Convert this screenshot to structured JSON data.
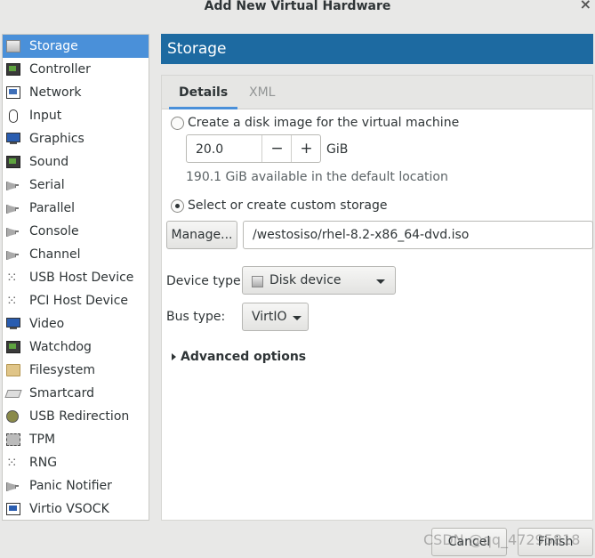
{
  "window": {
    "title": "Add New Virtual Hardware",
    "close_glyph": "×"
  },
  "sidebar": {
    "items": [
      {
        "label": "Storage",
        "icon": "disk-icon"
      },
      {
        "label": "Controller",
        "icon": "controller-chip-icon"
      },
      {
        "label": "Network",
        "icon": "network-card-icon"
      },
      {
        "label": "Input",
        "icon": "mouse-icon"
      },
      {
        "label": "Graphics",
        "icon": "monitor-icon"
      },
      {
        "label": "Sound",
        "icon": "sound-card-icon"
      },
      {
        "label": "Serial",
        "icon": "serial-plug-icon"
      },
      {
        "label": "Parallel",
        "icon": "parallel-plug-icon"
      },
      {
        "label": "Console",
        "icon": "console-plug-icon"
      },
      {
        "label": "Channel",
        "icon": "channel-plug-icon"
      },
      {
        "label": "USB Host Device",
        "icon": "usb-icon"
      },
      {
        "label": "PCI Host Device",
        "icon": "pci-icon"
      },
      {
        "label": "Video",
        "icon": "video-monitor-icon"
      },
      {
        "label": "Watchdog",
        "icon": "watchdog-chip-icon"
      },
      {
        "label": "Filesystem",
        "icon": "folder-icon"
      },
      {
        "label": "Smartcard",
        "icon": "smartcard-icon"
      },
      {
        "label": "USB Redirection",
        "icon": "usb-redirection-icon"
      },
      {
        "label": "TPM",
        "icon": "tpm-chip-icon"
      },
      {
        "label": "RNG",
        "icon": "rng-icon"
      },
      {
        "label": "Panic Notifier",
        "icon": "panic-notifier-icon"
      },
      {
        "label": "Virtio VSOCK",
        "icon": "vsock-monitor-icon"
      }
    ],
    "selected_index": 0
  },
  "header": {
    "title": "Storage"
  },
  "tabs": {
    "details": "Details",
    "xml": "XML"
  },
  "storage": {
    "create_disk_label": "Create a disk image for the virtual machine",
    "size_value": "20.0",
    "size_unit": "GiB",
    "minus": "−",
    "plus": "+",
    "available_text": "190.1 GiB available in the default location",
    "custom_label": "Select or create custom storage",
    "manage_label": "Manage...",
    "path_value": "/westosiso/rhel-8.2-x86_64-dvd.iso",
    "device_type_label": "Device type:",
    "device_type_value": "Disk device",
    "bus_type_label": "Bus type:",
    "bus_type_value": "VirtIO",
    "advanced_label": "Advanced options"
  },
  "footer": {
    "cancel_label": "Cancel",
    "finish_label": "Finish",
    "watermark": "CSDN @qq_47295818"
  },
  "colors": {
    "selection": "#4a90d9",
    "banner": "#1d6aa1"
  }
}
